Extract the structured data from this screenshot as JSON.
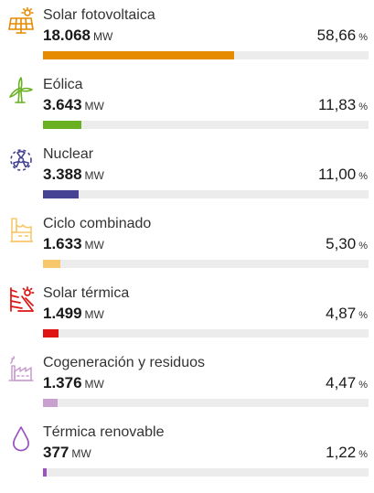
{
  "items": [
    {
      "name": "Solar fotovoltaica",
      "value": "18.068",
      "unit": "MW",
      "percent": "58,66",
      "percent_unit": "%",
      "share": 58.66,
      "color": "#e68a00",
      "icon": "solar-panel-icon"
    },
    {
      "name": "Eólica",
      "value": "3.643",
      "unit": "MW",
      "percent": "11,83",
      "percent_unit": "%",
      "share": 11.83,
      "color": "#6ab023",
      "icon": "wind-turbine-icon"
    },
    {
      "name": "Nuclear",
      "value": "3.388",
      "unit": "MW",
      "percent": "11,00",
      "percent_unit": "%",
      "share": 11.0,
      "color": "#464394",
      "icon": "radiation-icon"
    },
    {
      "name": "Ciclo combinado",
      "value": "1.633",
      "unit": "MW",
      "percent": "5,30",
      "percent_unit": "%",
      "share": 5.3,
      "color": "#f7c86a",
      "icon": "power-plant-icon"
    },
    {
      "name": "Solar térmica",
      "value": "1.499",
      "unit": "MW",
      "percent": "4,87",
      "percent_unit": "%",
      "share": 4.87,
      "color": "#e01313",
      "icon": "solar-thermal-icon"
    },
    {
      "name": "Cogeneración y residuos",
      "value": "1.376",
      "unit": "MW",
      "percent": "4,47",
      "percent_unit": "%",
      "share": 4.47,
      "color": "#c9a1cf",
      "icon": "factory-icon"
    },
    {
      "name": "Térmica renovable",
      "value": "377",
      "unit": "MW",
      "percent": "1,22",
      "percent_unit": "%",
      "share": 1.22,
      "color": "#9b52c0",
      "icon": "drop-icon"
    }
  ]
}
